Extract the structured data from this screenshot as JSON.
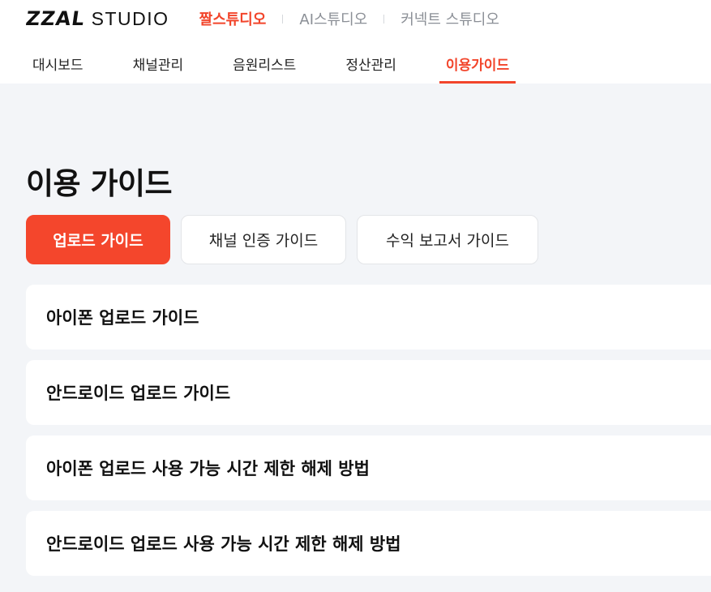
{
  "brand": {
    "mark": "ZZAL",
    "text": "STUDIO"
  },
  "studios": [
    {
      "label": "짤스튜디오",
      "active": true
    },
    {
      "label": "AI스튜디오",
      "active": false
    },
    {
      "label": "커넥트 스튜디오",
      "active": false
    }
  ],
  "nav": [
    {
      "label": "대시보드",
      "active": false
    },
    {
      "label": "채널관리",
      "active": false
    },
    {
      "label": "음원리스트",
      "active": false
    },
    {
      "label": "정산관리",
      "active": false
    },
    {
      "label": "이용가이드",
      "active": true
    }
  ],
  "page": {
    "title": "이용 가이드"
  },
  "tabs": [
    {
      "label": "업로드 가이드",
      "active": true
    },
    {
      "label": "채널 인증 가이드",
      "active": false
    },
    {
      "label": "수익 보고서 가이드",
      "active": false
    }
  ],
  "guides": [
    "아이폰 업로드 가이드",
    "안드로이드 업로드 가이드",
    "아이폰 업로드 사용 가능 시간 제한 해제 방법",
    "안드로이드 업로드 사용 가능 시간 제한 해제 방법"
  ],
  "colors": {
    "accent": "#f2452b",
    "background": "#f3f5f8"
  }
}
